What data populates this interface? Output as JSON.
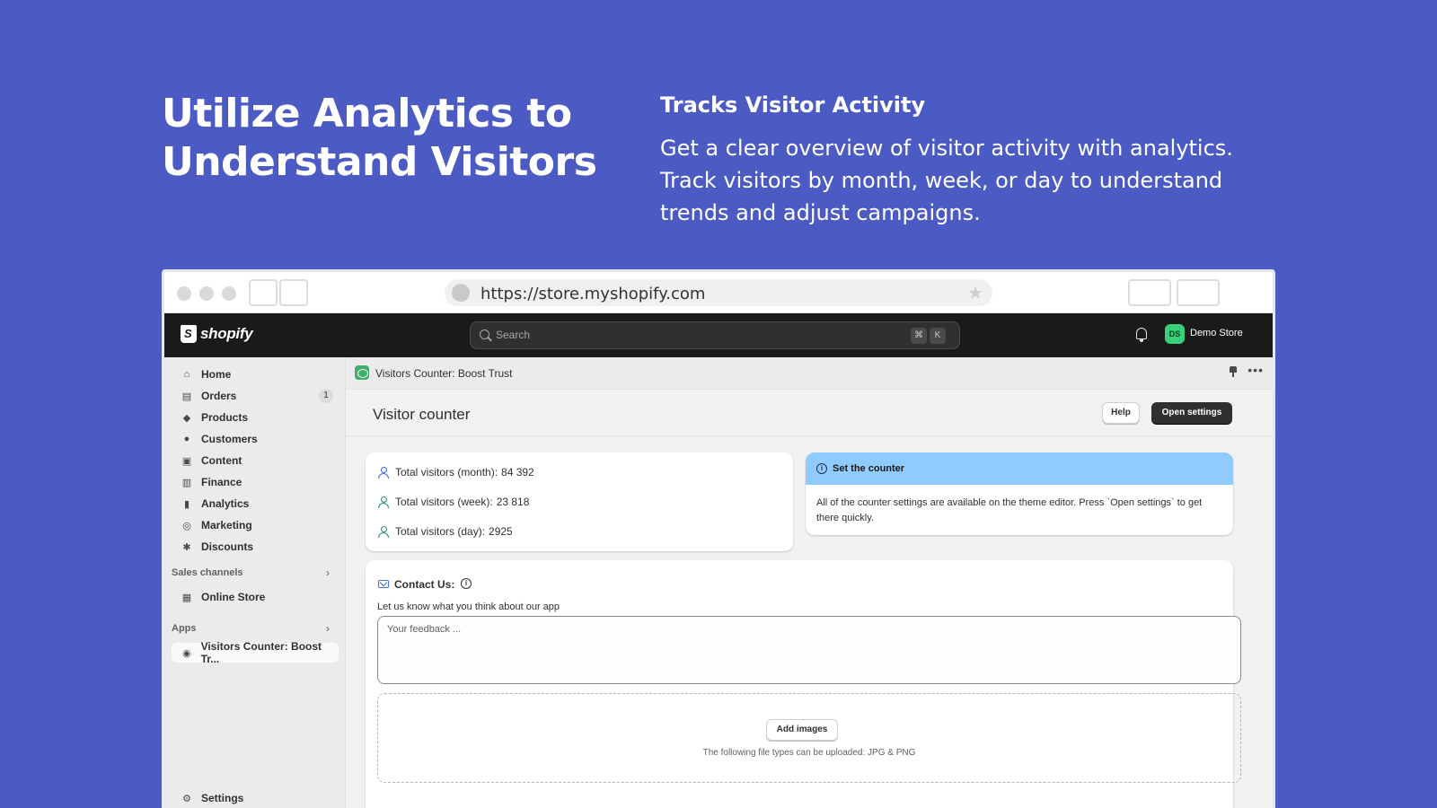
{
  "hero": {
    "title_line1": "Utilize Analytics to",
    "title_line2": "Understand Visitors",
    "subtitle": "Tracks Visitor Activity",
    "description": "Get a clear overview of visitor activity with analytics. Track visitors by month, week, or day to understand trends and adjust campaigns."
  },
  "browser": {
    "url": "https://store.myshopify.com"
  },
  "topbar": {
    "brand": "shopify",
    "search_placeholder": "Search",
    "shortcut_key1": "⌘",
    "shortcut_key2": "K",
    "store_initials": "DS",
    "store_name": "Demo Store"
  },
  "sidebar": {
    "items": [
      {
        "label": "Home",
        "icon": "home-icon"
      },
      {
        "label": "Orders",
        "icon": "inbox-icon",
        "badge": "1"
      },
      {
        "label": "Products",
        "icon": "tag-icon"
      },
      {
        "label": "Customers",
        "icon": "person-icon"
      },
      {
        "label": "Content",
        "icon": "content-icon"
      },
      {
        "label": "Finance",
        "icon": "bank-icon"
      },
      {
        "label": "Analytics",
        "icon": "bar-chart-icon"
      },
      {
        "label": "Marketing",
        "icon": "target-icon"
      },
      {
        "label": "Discounts",
        "icon": "discount-icon"
      }
    ],
    "sales_channels_label": "Sales channels",
    "online_store_label": "Online Store",
    "apps_label": "Apps",
    "app_item_label": "Visitors Counter: Boost Tr...",
    "settings_label": "Settings"
  },
  "app": {
    "header_title": "Visitors Counter: Boost Trust",
    "page_title": "Visitor counter",
    "help_label": "Help",
    "open_settings_label": "Open settings"
  },
  "stats": {
    "month_label": "Total visitors (month):",
    "month_value": "84 392",
    "week_label": "Total visitors (week):",
    "week_value": "23 818",
    "day_label": "Total visitors (day):",
    "day_value": "2925"
  },
  "info": {
    "title": "Set the counter",
    "text": "All of the counter settings are available on the theme editor. Press `Open settings` to get there quickly."
  },
  "contact": {
    "title": "Contact Us:",
    "prompt": "Let us know what you think about our app",
    "feedback_placeholder": "Your feedback ...",
    "add_images_label": "Add images",
    "file_types_hint": "The following file types can be uploaded: JPG & PNG"
  },
  "colors": {
    "background": "#4c5bc4",
    "info_header": "#8fcbff",
    "store_avatar": "#36d17a",
    "primary_button": "#303030"
  }
}
